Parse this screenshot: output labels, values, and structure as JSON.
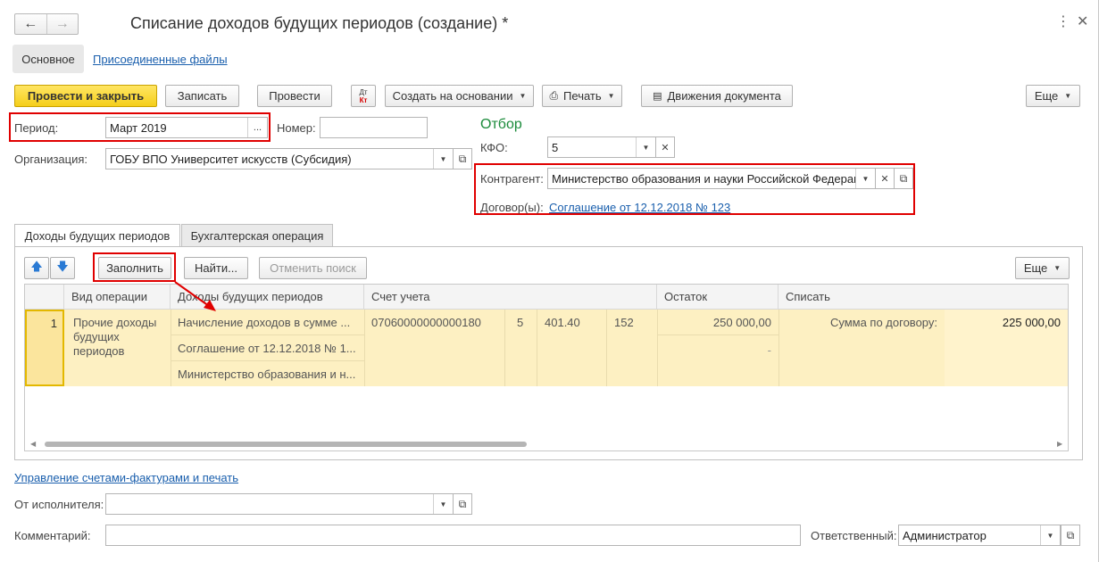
{
  "window": {
    "title": "Списание доходов будущих периодов (создание) *",
    "more_icon": "more-vertical-icon",
    "close_icon": "close-icon"
  },
  "form_tabs": {
    "main": "Основное",
    "files": "Присоединенные файлы"
  },
  "toolbar": {
    "post_close": "Провести и закрыть",
    "save": "Записать",
    "post": "Провести",
    "dtkt_icon": "Дт/Кт",
    "dt": "Дт",
    "kt": "Кт",
    "create_basis": "Создать на основании",
    "print": "Печать",
    "movements": "Движения документа",
    "more": "Еще"
  },
  "fields": {
    "period_label": "Период:",
    "period_value": "Март 2019",
    "number_label": "Номер:",
    "number_value": "",
    "org_label": "Организация:",
    "org_value": "ГОБУ ВПО Университет искусств (Субсидия)"
  },
  "filter": {
    "title": "Отбор",
    "kfo_label": "КФО:",
    "kfo_value": "5",
    "contractor_label": "Контрагент:",
    "contractor_value": "Министерство образования и науки Российской Федерации",
    "contract_label": "Договор(ы):",
    "contract_link": "Соглашение от 12.12.2018 № 123"
  },
  "tabs": [
    {
      "label": "Доходы будущих периодов",
      "active": true
    },
    {
      "label": "Бухгалтерская операция",
      "active": false
    }
  ],
  "table_toolbar": {
    "fill": "Заполнить",
    "find": "Найти...",
    "cancel_search": "Отменить поиск",
    "more": "Еще"
  },
  "table": {
    "columns": [
      "Вид операции",
      "Доходы будущих периодов",
      "Счет учета",
      "Остаток",
      "Списать"
    ],
    "row": {
      "num": "1",
      "op_type": [
        "Прочие доходы",
        "будущих",
        "периодов"
      ],
      "income": [
        "Начисление доходов в сумме ...",
        "Соглашение от 12.12.2018 № 1...",
        "Министерство образования и н..."
      ],
      "account": "07060000000000180",
      "kfo": "5",
      "kps": "401.40",
      "kosgu": "152",
      "balance": "250 000,00",
      "balance2": "-",
      "write_label": "Сумма по договору:",
      "write_value": "225 000,00"
    }
  },
  "footer": {
    "invoices_link": "Управление счетами-фактурами и печать",
    "executor_label": "От исполнителя:",
    "executor_value": "",
    "comment_label": "Комментарий:",
    "comment_value": "",
    "responsible_label": "Ответственный:",
    "responsible_value": "Администратор"
  },
  "colors": {
    "accent_yellow": "#f5cf1a",
    "highlight_red": "#e00000",
    "row_bg": "#fdf0c2",
    "link_blue": "#1a5fad",
    "filter_green": "#1a8a3a"
  }
}
